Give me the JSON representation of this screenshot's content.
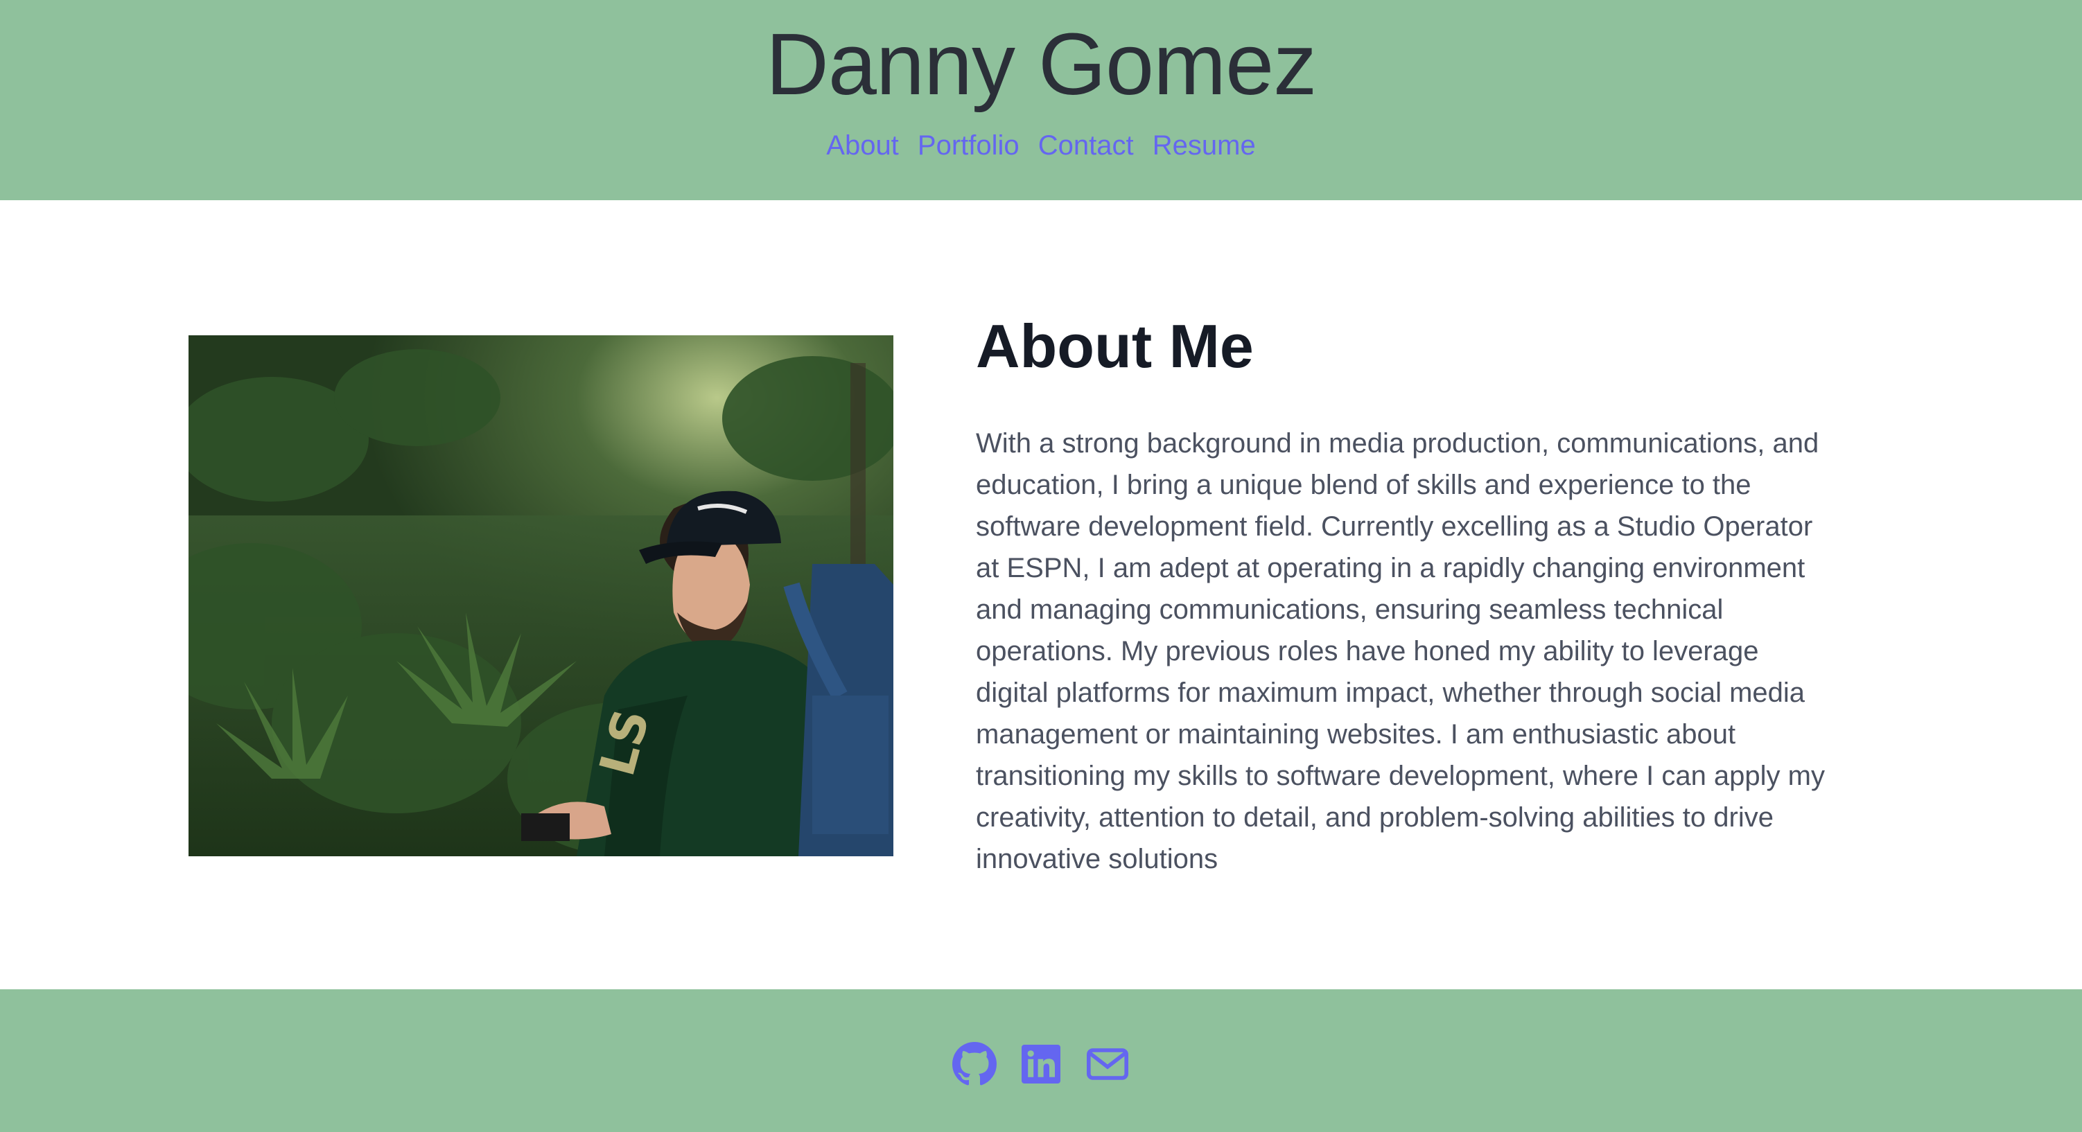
{
  "header": {
    "title": "Danny Gomez",
    "nav": [
      {
        "label": "About"
      },
      {
        "label": "Portfolio"
      },
      {
        "label": "Contact"
      },
      {
        "label": "Resume"
      }
    ]
  },
  "about": {
    "heading": "About Me",
    "text": "With a strong background in media production, communications, and education, I bring a unique blend of skills and experience to the software development field. Currently excelling as a Studio Operator at ESPN, I am adept at operating in a rapidly changing environment and managing communications, ensuring seamless technical operations. My previous roles have honed my ability to leverage digital platforms for maximum impact, whether through social media management or maintaining websites. I am enthusiastic about transitioning my skills to software development, where I can apply my creativity, attention to detail, and problem-solving abilities to drive innovative solutions"
  },
  "footer": {
    "icons": [
      "github-icon",
      "linkedin-icon",
      "email-icon"
    ]
  },
  "colors": {
    "header_bg": "#8fc19c",
    "link": "#6466f0",
    "heading": "#161b26",
    "body_text": "#4b5160"
  }
}
